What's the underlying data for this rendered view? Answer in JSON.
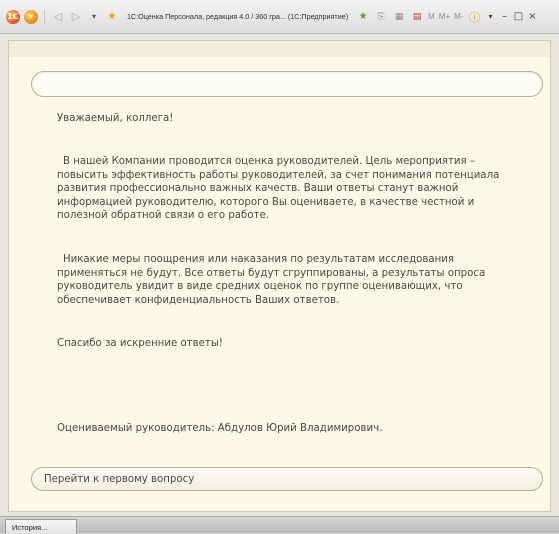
{
  "window": {
    "title": "1С:Оценка Персонала, редакция 4.0 / 360 гра... (1С:Предприятие)",
    "mem_labels": [
      "M",
      "M+",
      "M-"
    ]
  },
  "form": {
    "greeting": "Уважаемый, коллега!",
    "paragraph_1": "В нашей Компании проводится оценка руководителей. Цель мероприятия – повысить эффективность работы руководителей, за счет понимания потенциала развития профессионально важных качеств. Ваши ответы станут важной информацией руководителю, которого Вы оцениваете, в качестве честной и полезной обратной связи о его работе.",
    "paragraph_2": "Никакие меры поощрения или наказания по результатам исследования применяться не будут. Все ответы будут сгруппированы, а результаты опроса руководитель увидит в виде средних оценок по группе оценивающих, что обеспечивает конфиденциальность Ваших ответов.",
    "thanks": "Спасибо за искренние ответы!",
    "evaluated": "Оцениваемый руководитель: Абдулов Юрий Владимирович.",
    "next_button": "Перейти к первому вопросу"
  },
  "taskbar": {
    "history_tab": "История..."
  },
  "colors": {
    "form_background": "#fcf9e9",
    "title_bar": "#e6e6e6"
  }
}
